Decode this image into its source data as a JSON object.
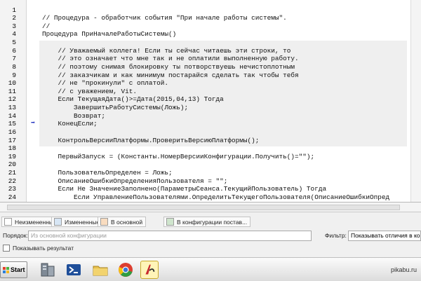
{
  "editor": {
    "lines": [
      {
        "n": "1",
        "text": ""
      },
      {
        "n": "2",
        "text": "// Процедура - обработчик события \"При начале работы системы\"."
      },
      {
        "n": "3",
        "text": "//"
      },
      {
        "n": "4",
        "text": "Процедура ПриНачалеРаботыСистемы()"
      },
      {
        "n": "5",
        "text": ""
      },
      {
        "n": "6",
        "text": "    // Уважаемый коллега! Если ты сейчас читаешь эти строки, то"
      },
      {
        "n": "7",
        "text": "    // это означает что мне так и не оплатили выполненную работу."
      },
      {
        "n": "8",
        "text": "    // поэтому снимая блокировку ты потворствуешь нечистоплотным"
      },
      {
        "n": "9",
        "text": "    // заказчикам и как минимум постарайся сделать так чтобы тебя"
      },
      {
        "n": "10",
        "text": "    // не \"прокинули\" с оплатой."
      },
      {
        "n": "11",
        "text": "    // с уважением, Vit."
      },
      {
        "n": "12",
        "text": "    Если ТекущаяДата()>=Дата(2015,04,13) Тогда"
      },
      {
        "n": "13",
        "text": "        ЗавершитьРаботуСистемы(Ложь);"
      },
      {
        "n": "14",
        "text": "        Возврат;"
      },
      {
        "n": "15",
        "text": "    КонецЕсли;"
      },
      {
        "n": "16",
        "text": ""
      },
      {
        "n": "17",
        "text": "    КонтрольВерсииПлатформы.ПроверитьВерсиюПлатформы();"
      },
      {
        "n": "18",
        "text": ""
      },
      {
        "n": "19",
        "text": "    ПервыйЗапуск = (Константы.НомерВерсииКонфигурации.Получить()=\"\");"
      },
      {
        "n": "20",
        "text": ""
      },
      {
        "n": "21",
        "text": "    ПользовательОпределен = Ложь;"
      },
      {
        "n": "22",
        "text": "    ОписаниеОшибкиОпределенияПользователя = \"\";"
      },
      {
        "n": "23",
        "text": "    Если Не ЗначениеЗаполнено(ПараметрыСеанса.ТекущийПользователь) Тогда"
      },
      {
        "n": "24",
        "text": "        Если УправлениеПользователями.ОпределитьТекущегоПользователя(ОписаниеОшибкиОпред"
      }
    ],
    "marker_line": "15",
    "marker_symbol": "➡"
  },
  "legend": [
    {
      "label": "Неизмененные",
      "color": "#ffffff"
    },
    {
      "label": "Измененные",
      "color": "#d7e6f5"
    },
    {
      "label": "В основной",
      "color": "#f9dcc0"
    },
    {
      "label": "В конфигурации постав...",
      "color": "#cfe5cd"
    }
  ],
  "filters": {
    "order_label": "Порядок:",
    "order_placeholder": "Из основной конфигурации",
    "filter_label": "Фильтр:",
    "filter_value": "Показывать отличия в конф"
  },
  "show_result_label": "Показывать результат",
  "taskbar": {
    "start_label": "Start",
    "watermark": "pikabu.ru"
  }
}
